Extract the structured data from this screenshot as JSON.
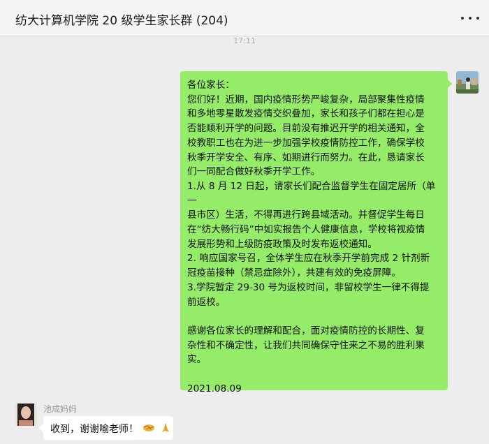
{
  "window": {
    "title": "纺大计算机学院 20 级学生家长群 (204)"
  },
  "chat": {
    "timestamp": "17:11",
    "messages": [
      {
        "from": "self",
        "lines": [
          "各位家长：",
          "您们好！近期，国内疫情形势严峻复杂，局部聚集性疫情",
          "和多地零星散发疫情交织叠加，家长和孩子们都在担心是",
          "否能顺利开学的问题。目前没有推迟开学的相关通知，全",
          "校教职工也在为进一步加强学校疫情防控工作，确保学校",
          "秋季开学安全、有序、如期进行而努力。在此，恳请家长",
          "们一同配合做好秋季开学工作。",
          "1.从 8 月 12 日起，请家长们配合监督学生在固定居所（单一",
          "县市区）生活，不得再进行跨县域活动。并督促学生每日",
          "在“纺大畅行码”中如实报告个人健康信息，学校将视疫情",
          "发展形势和上级防疫政策及时发布返校通知。",
          "2. 响应国家号召，全体学生应在秋季开学前完成 2 针剂新",
          "冠疫苗接种（禁忌症除外），共建有效的免疫屏障。",
          "3.学院暂定 29-30 号为返校时间，非留校学生一律不得提",
          "前返校。",
          "",
          "感谢各位家长的理解和配合，面对疫情防控的长期性、复",
          "杂性和不确定性，让我们共同确保守住来之不易的胜利果",
          "实。",
          "",
          "2021.08.09"
        ]
      },
      {
        "from": "other",
        "sender": "池成妈妈",
        "text": "收到，谢谢喻老师！",
        "emojis": [
          "handshake-emoji",
          "folded-hands-emoji"
        ]
      }
    ]
  },
  "colors": {
    "self_bubble": "#95ec69",
    "other_bubble": "#ffffff",
    "background": "#ededed"
  }
}
